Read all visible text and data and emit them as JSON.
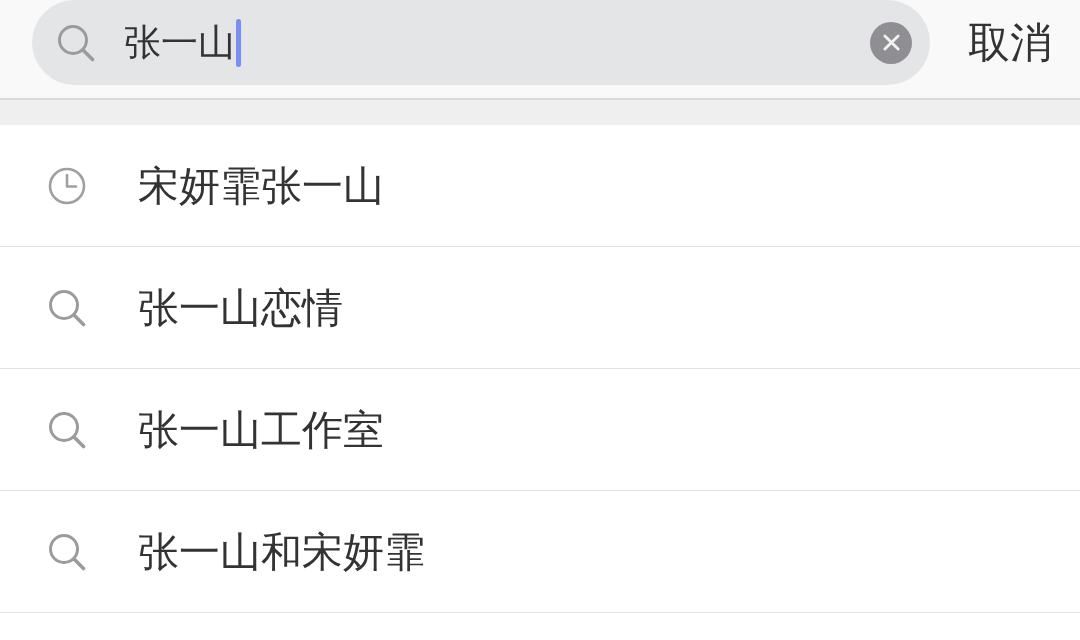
{
  "search": {
    "value": "张一山",
    "focused": true
  },
  "cancel_button": {
    "label": "取消"
  },
  "suggestions": [
    {
      "kind": "history",
      "text": "宋妍霏张一山"
    },
    {
      "kind": "search",
      "text": "张一山恋情"
    },
    {
      "kind": "search",
      "text": "张一山工作室"
    },
    {
      "kind": "search",
      "text": "张一山和宋妍霏"
    }
  ]
}
